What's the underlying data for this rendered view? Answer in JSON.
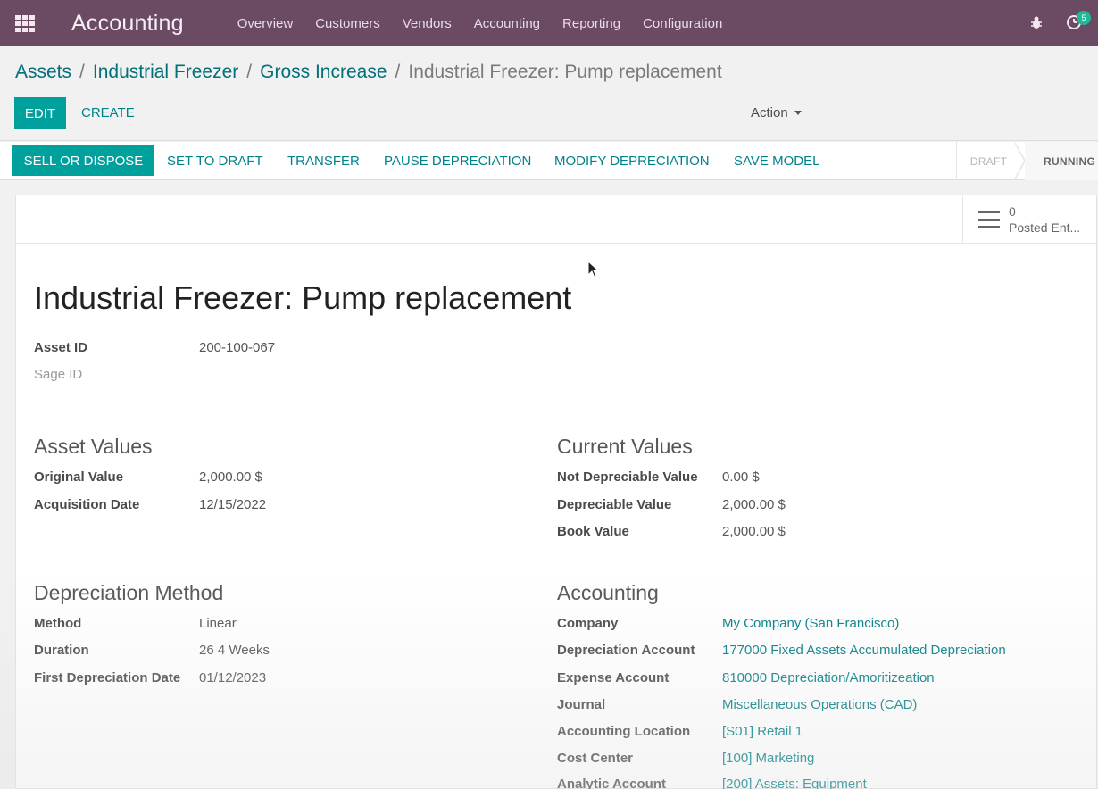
{
  "navbar": {
    "app_title": "Accounting",
    "menu": [
      "Overview",
      "Customers",
      "Vendors",
      "Accounting",
      "Reporting",
      "Configuration"
    ],
    "badge_count": "5",
    "color": "#6b4a63"
  },
  "breadcrumb": {
    "items": [
      "Assets",
      "Industrial Freezer",
      "Gross Increase"
    ],
    "separator": "/",
    "current": "Industrial Freezer: Pump replacement"
  },
  "control": {
    "edit_label": "EDIT",
    "create_label": "CREATE",
    "action_label": "Action"
  },
  "statusbar": {
    "buttons": [
      "SELL OR DISPOSE",
      "SET TO DRAFT",
      "TRANSFER",
      "PAUSE DEPRECIATION",
      "MODIFY DEPRECIATION",
      "SAVE MODEL"
    ],
    "stages": [
      "DRAFT",
      "RUNNING"
    ],
    "accent": "#00a09d"
  },
  "stat_button": {
    "count": "0",
    "label": "Posted Ent..."
  },
  "record": {
    "title": "Industrial Freezer: Pump replacement",
    "asset_id_label": "Asset ID",
    "asset_id_value": "200-100-067",
    "sage_id_label": "Sage ID"
  },
  "asset_values": {
    "title": "Asset Values",
    "original_value_label": "Original Value",
    "original_value": "2,000.00 $",
    "acquisition_date_label": "Acquisition Date",
    "acquisition_date": "12/15/2022"
  },
  "current_values": {
    "title": "Current Values",
    "not_depreciable_label": "Not Depreciable Value",
    "not_depreciable": "0.00 $",
    "depreciable_label": "Depreciable Value",
    "depreciable": "2,000.00 $",
    "book_value_label": "Book Value",
    "book_value": "2,000.00 $"
  },
  "depreciation": {
    "title": "Depreciation Method",
    "method_label": "Method",
    "method": "Linear",
    "duration_label": "Duration",
    "duration_number": "26",
    "duration_unit": "4 Weeks",
    "first_date_label": "First Depreciation Date",
    "first_date": "01/12/2023"
  },
  "accounting": {
    "title": "Accounting",
    "company_label": "Company",
    "company": "My Company (San Francisco)",
    "dep_account_label": "Depreciation Account",
    "dep_account": "177000 Fixed Assets Accumulated Depreciation",
    "exp_account_label": "Expense Account",
    "exp_account": "810000 Depreciation/Amoritizeation",
    "journal_label": "Journal",
    "journal": "Miscellaneous Operations (CAD)",
    "location_label": "Accounting Location",
    "location": "[S01] Retail 1",
    "cost_center_label": "Cost Center",
    "cost_center": "[100] Marketing",
    "analytic_label": "Analytic Account",
    "analytic": "[200] Assets: Equipment"
  }
}
